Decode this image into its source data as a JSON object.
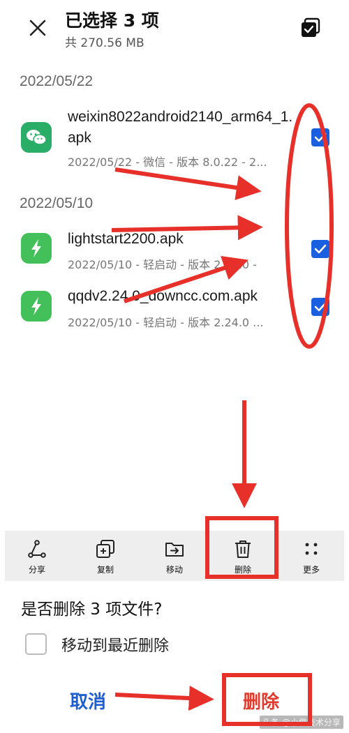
{
  "header": {
    "title": "已选择 3 项",
    "subtitle": "共 270.56 MB"
  },
  "groups": [
    {
      "date": "2022/05/22",
      "files": [
        {
          "name": "weixin8022android2140_arm64_1.apk",
          "meta": "2022/05/22 - 微信 - 版本 8.0.22 - 2...",
          "icon": "wechat-icon",
          "checked": true
        }
      ]
    },
    {
      "date": "2022/05/10",
      "files": [
        {
          "name": "lightstart2200.apk",
          "meta": "2022/05/10 - 轻启动 - 版本 2.20.0 -",
          "icon": "lightning-icon",
          "checked": true
        },
        {
          "name": "qqdv2.24.0_downcc.com.apk",
          "meta": "2022/05/10 - 轻启动 - 版本 2.24.0 ...",
          "icon": "lightning-icon",
          "checked": true
        }
      ]
    }
  ],
  "actions": [
    {
      "label": "分享",
      "icon": "share-icon"
    },
    {
      "label": "复制",
      "icon": "copy-icon"
    },
    {
      "label": "移动",
      "icon": "move-folder-icon"
    },
    {
      "label": "删除",
      "icon": "trash-icon"
    },
    {
      "label": "更多",
      "icon": "more-dots-icon"
    }
  ],
  "dialog": {
    "title": "是否删除 3 项文件?",
    "checkbox_label": "移动到最近删除",
    "cancel_label": "取消",
    "delete_label": "删除"
  },
  "watermark": "头条 @小俊技术分享",
  "colors": {
    "accent": "#1a5fe0",
    "annotation_red": "#e8302a",
    "wechat_green": "#2aae67",
    "app_green": "#43c05a",
    "cancel_blue": "#1d5fd0",
    "action_bar_bg": "#eeeeee"
  }
}
